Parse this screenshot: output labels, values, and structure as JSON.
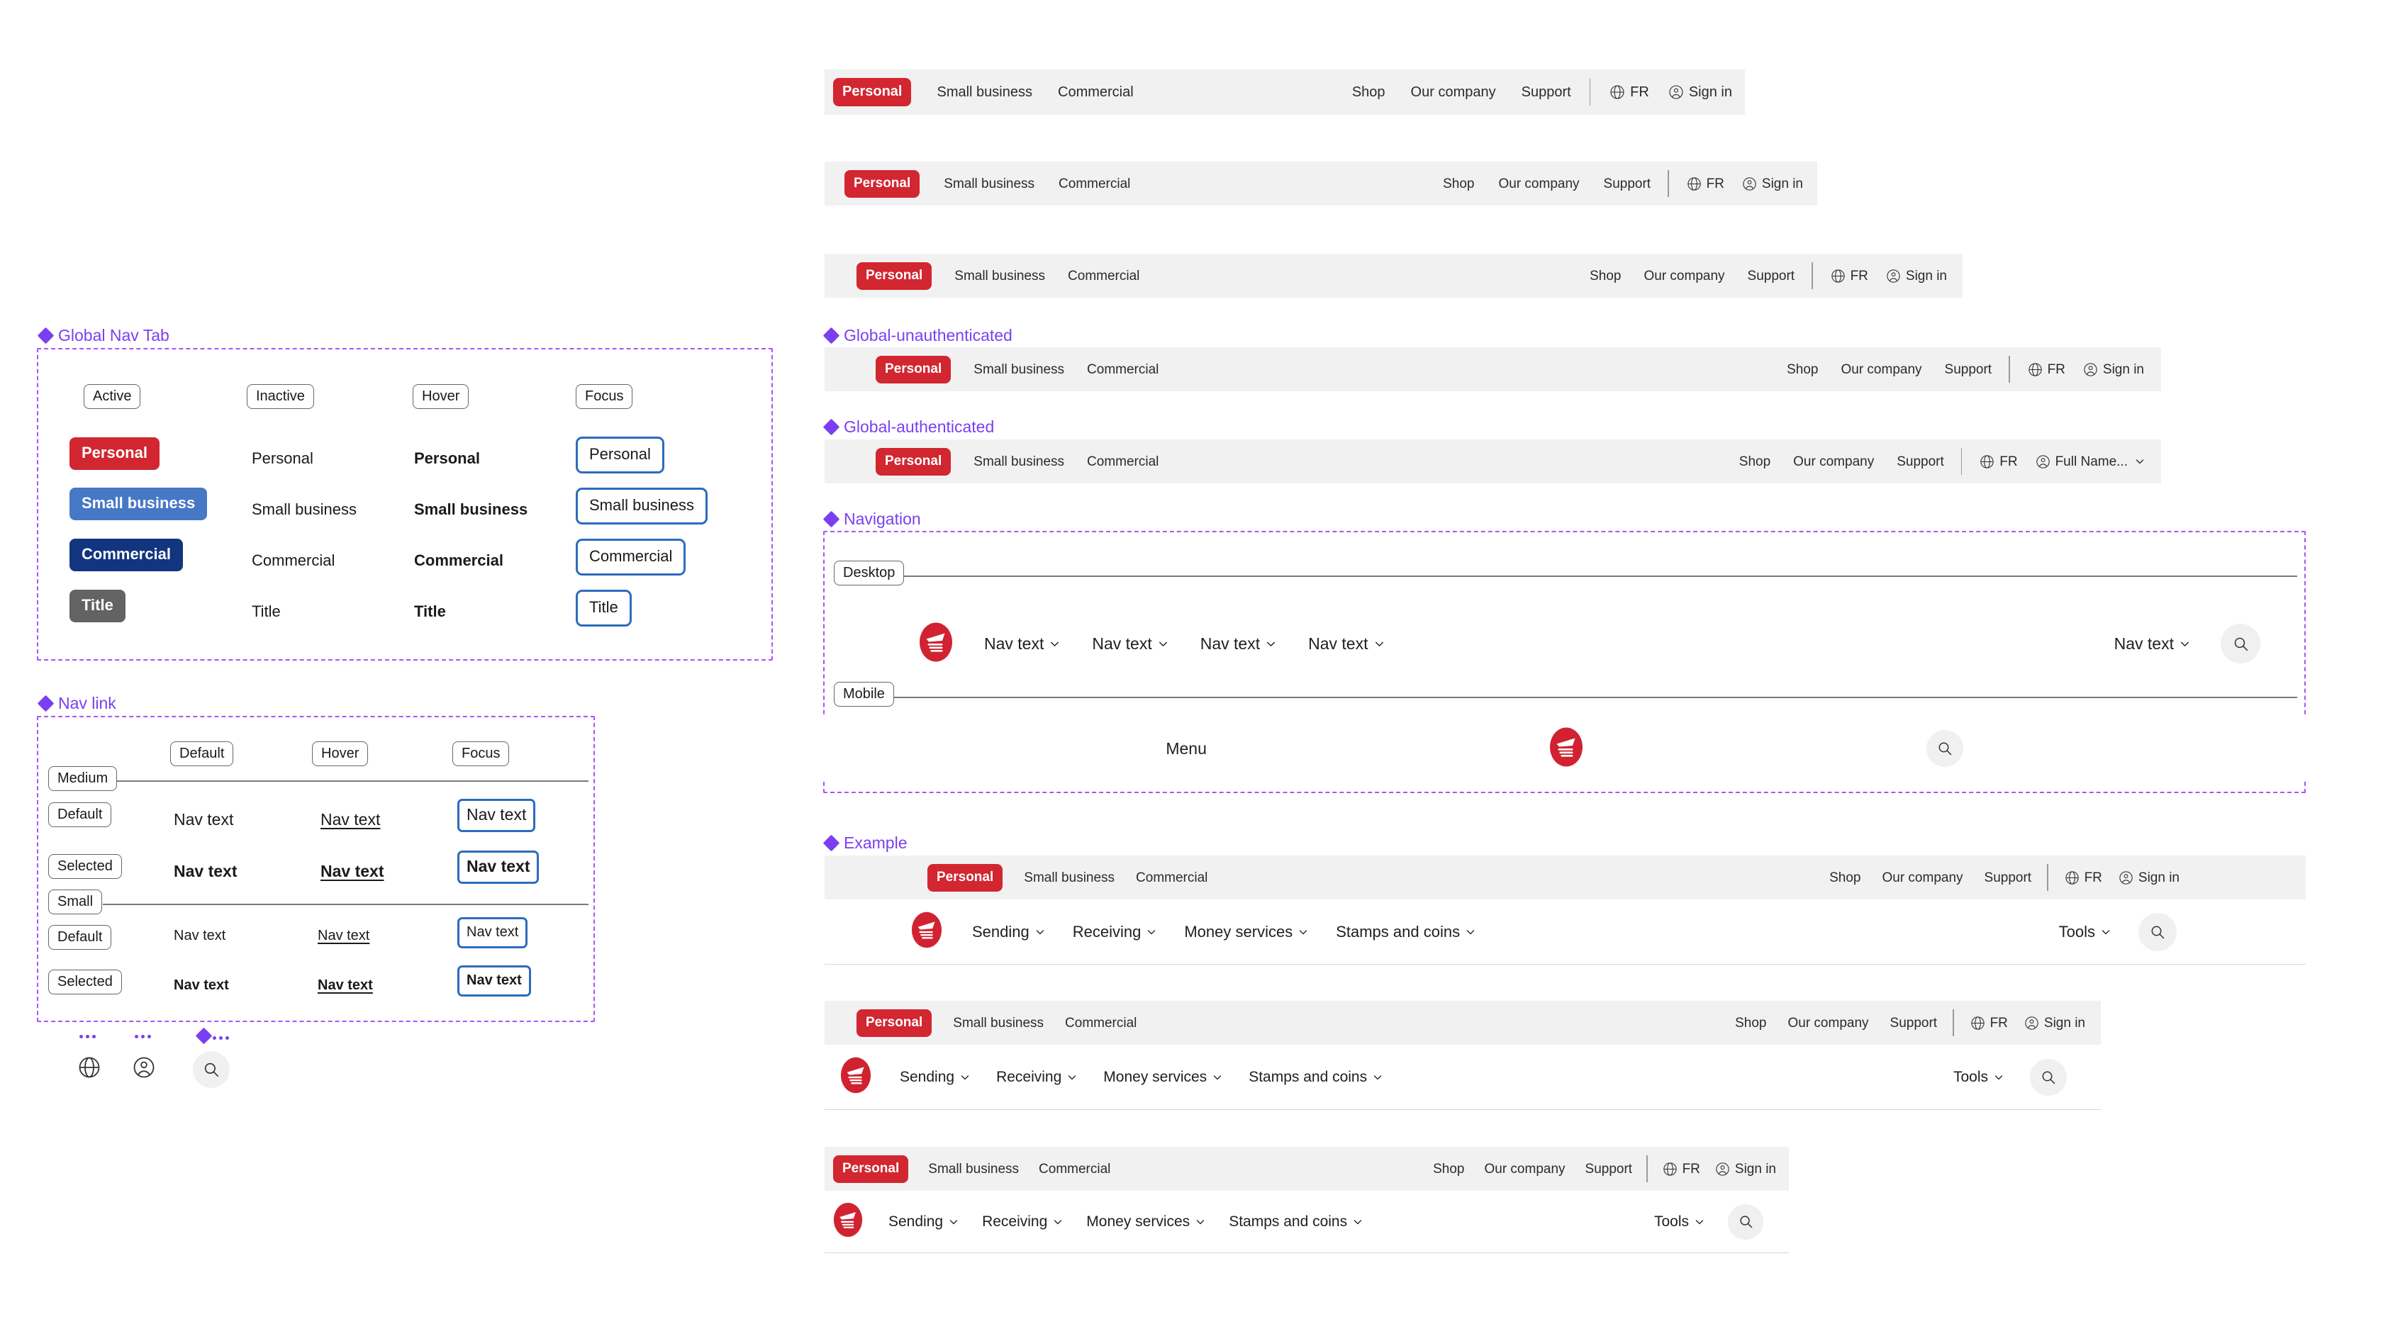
{
  "sections": {
    "global_nav_tab": "Global Nav Tab",
    "nav_link": "Nav link",
    "global_unauthenticated": "Global-unauthenticated",
    "global_authenticated": "Global-authenticated",
    "navigation": "Navigation",
    "example": "Example"
  },
  "global_nav_tab": {
    "columns": [
      "Active",
      "Inactive",
      "Hover",
      "Focus"
    ],
    "rows": [
      "Personal",
      "Small business",
      "Commercial",
      "Title"
    ],
    "colors": {
      "personal": "#D22630",
      "small_business": "#4778C5",
      "commercial": "#12357F",
      "title": "#636363",
      "focus_ring": "#2C6CBE"
    }
  },
  "nav_link": {
    "columns": [
      "Default",
      "Hover",
      "Focus"
    ],
    "groups": [
      {
        "size": "Medium",
        "states": [
          "Default",
          "Selected"
        ]
      },
      {
        "size": "Small",
        "states": [
          "Default",
          "Selected"
        ]
      }
    ],
    "sample_text": "Nav text"
  },
  "icon_specimens": [
    {
      "name": "globe-icon"
    },
    {
      "name": "account-icon"
    },
    {
      "name": "search-icon"
    }
  ],
  "global_bar": {
    "tab_active": "Personal",
    "tabs": [
      "Small business",
      "Commercial"
    ],
    "links": [
      "Shop",
      "Our company",
      "Support"
    ],
    "language": "FR",
    "signin": "Sign in",
    "account_name": "Full Name...",
    "bg": "#F1F1F1"
  },
  "navigation": {
    "desktop_label": "Desktop",
    "mobile_label": "Mobile",
    "nav_items": [
      "Nav text",
      "Nav text",
      "Nav text",
      "Nav text"
    ],
    "right_item": "Nav text",
    "mobile_menu": "Menu"
  },
  "example": {
    "nav_items": [
      "Sending",
      "Receiving",
      "Money services",
      "Stamps and coins"
    ],
    "tools": "Tools"
  }
}
